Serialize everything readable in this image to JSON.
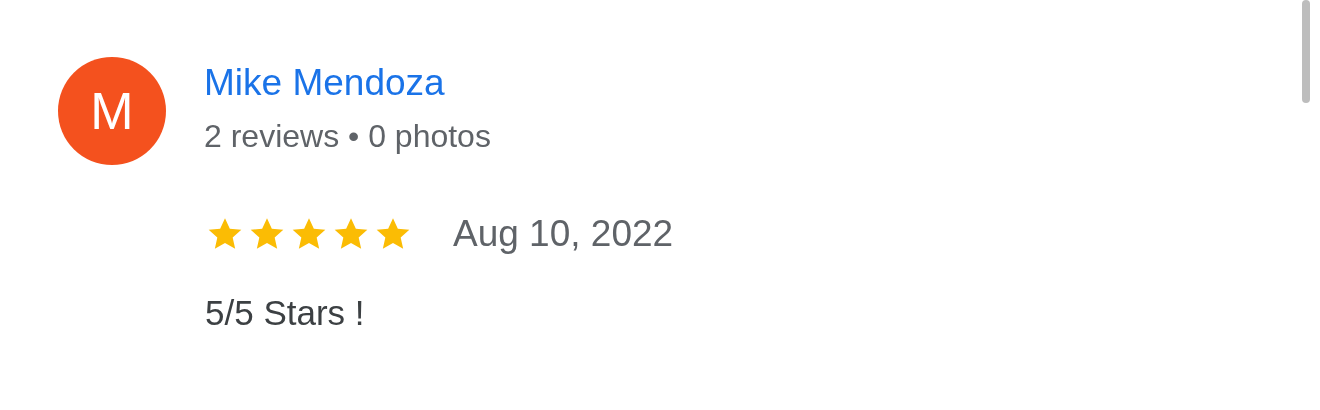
{
  "review": {
    "avatar_letter": "M",
    "author": "Mike Mendoza",
    "meta": "2 reviews • 0 photos",
    "stars": 5,
    "date": "Aug 10, 2022",
    "text": "5/5 Stars !"
  }
}
